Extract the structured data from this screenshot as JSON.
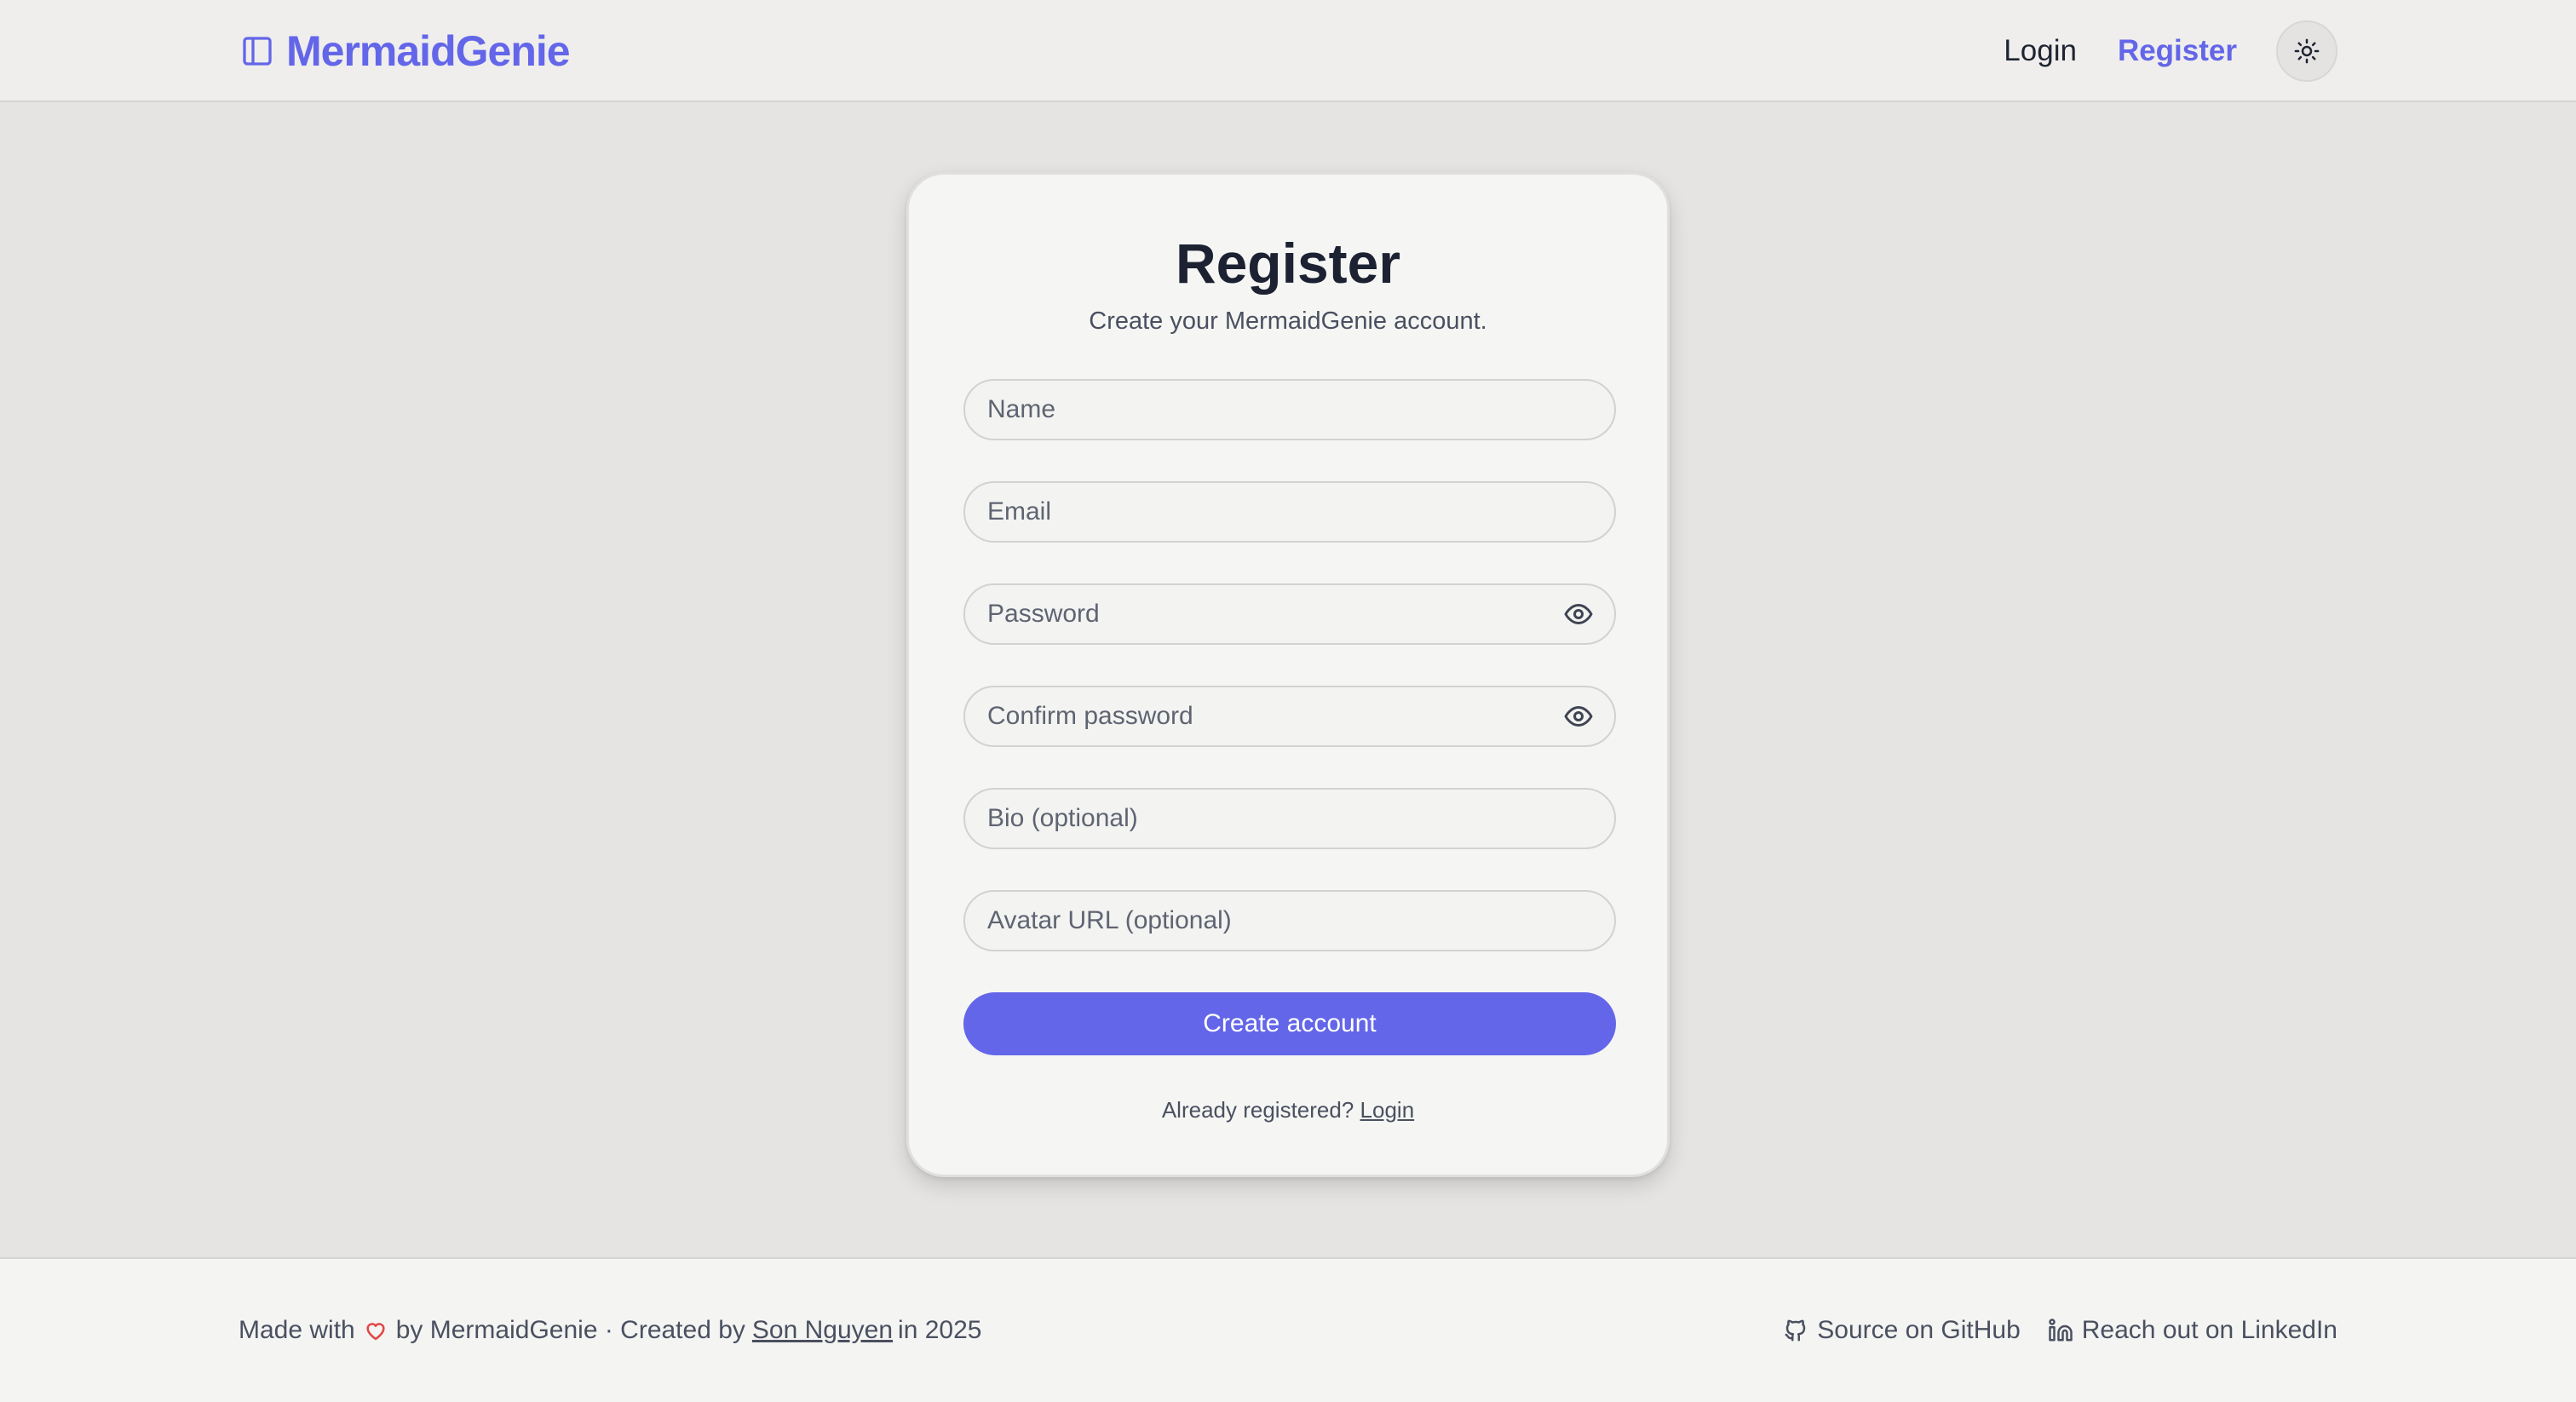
{
  "header": {
    "brand": "MermaidGenie",
    "nav": {
      "login": "Login",
      "register": "Register"
    },
    "theme_toggle_icon": "sun-icon"
  },
  "colors": {
    "accent": "#6366e8",
    "background": "#e5e4e2",
    "card": "#f5f5f3",
    "heart": "#e04848"
  },
  "form": {
    "title": "Register",
    "subtitle": "Create your MermaidGenie account.",
    "fields": {
      "name": {
        "placeholder": "Name",
        "value": ""
      },
      "email": {
        "placeholder": "Email",
        "value": ""
      },
      "password": {
        "placeholder": "Password",
        "value": ""
      },
      "confirm_password": {
        "placeholder": "Confirm password",
        "value": ""
      },
      "bio": {
        "placeholder": "Bio (optional)",
        "value": ""
      },
      "avatar_url": {
        "placeholder": "Avatar URL (optional)",
        "value": ""
      }
    },
    "submit_label": "Create account",
    "already_text": "Already registered?",
    "login_link": "Login"
  },
  "footer": {
    "made_with": "Made with",
    "by_text": "by MermaidGenie · Created by",
    "author": "Son Nguyen",
    "year_text": "in 2025",
    "github_label": "Source on GitHub",
    "linkedin_label": "Reach out on LinkedIn"
  }
}
